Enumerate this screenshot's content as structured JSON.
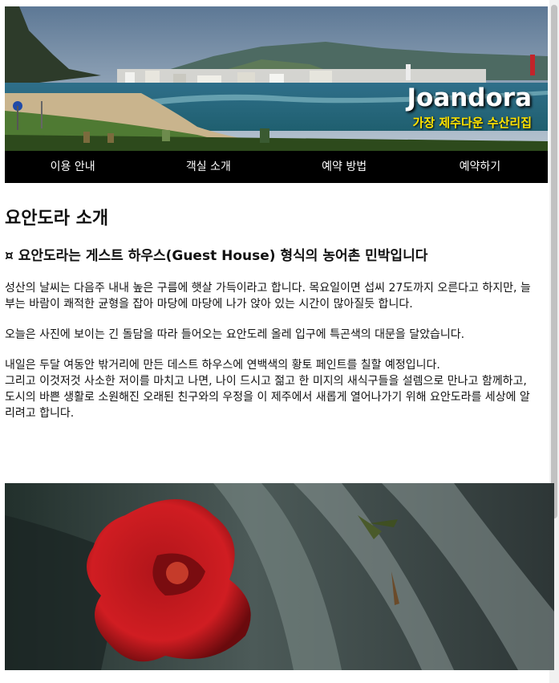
{
  "brand": {
    "title": "Joandora",
    "tagline": "가장 제주다운 수산리집"
  },
  "nav": {
    "items": [
      "이용 안내",
      "객실 소개",
      "예약 방법",
      "예약하기"
    ]
  },
  "main": {
    "heading": "요안도라 소개",
    "subheading": "¤ 요안도라는 게스트 하우스(Guest House) 형식의 농어촌 민박입니다",
    "paragraphs": [
      "성산의 날씨는 다음주 내내 높은 구름에 햇살 가득이라고 합니다. 목요일이면 섭씨 27도까지 오른다고 하지만, 늘 부는 바람이 쾌적한 균형을 잡아 마당에 마당에 나가 앉아 있는 시간이 많아질듯 합니다.",
      "오늘은 사진에 보이는 긴 돌담을 따라 들어오는 요안도레 올레 입구에 특곤색의 대문을 달았습니다.",
      "내일은 두달 여동안 밖거리에 만든 데스트 하우스에 연백색의 황토 페인트를 칠할 예정입니다.",
      "그리고 이것저것 사소한 저이를 마치고 나면, 나이 드시고 젊고 한 미지의 새식구들을 설렘으로 만나고 함께하고, 도시의 바쁜 생활로 소원해진 오래된 친구와의 우정을 이 제주에서 새롭게 열어나가기 위해 요안도라를 세상에 알리려고 합니다."
    ]
  },
  "colors": {
    "nav_bg": "#000000",
    "tagline": "#ffe300",
    "title": "#ffffff"
  }
}
